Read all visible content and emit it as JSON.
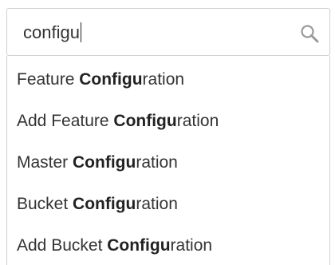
{
  "search": {
    "value": "configu",
    "icon": "search-icon"
  },
  "suggestions": [
    {
      "before": "Feature ",
      "match": "Configu",
      "after": "ration"
    },
    {
      "before": "Add Feature ",
      "match": "Configu",
      "after": "ration"
    },
    {
      "before": "Master ",
      "match": "Configu",
      "after": "ration"
    },
    {
      "before": "Bucket ",
      "match": "Configu",
      "after": "ration"
    },
    {
      "before": "Add Bucket ",
      "match": "Configu",
      "after": "ration"
    }
  ],
  "colors": {
    "text": "#333333",
    "border": "#d0d0d0",
    "icon": "#9a9a9a"
  }
}
